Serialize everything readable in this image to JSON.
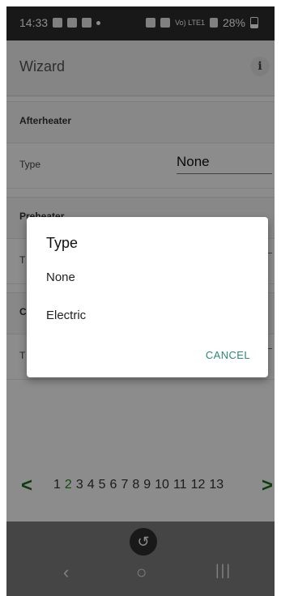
{
  "status_bar": {
    "time": "14:33",
    "battery": "28%",
    "net": "Vo) LTE1"
  },
  "app_bar": {
    "title": "Wizard",
    "info_icon": "i"
  },
  "sections": {
    "afterheater": {
      "title": "Afterheater",
      "type_label": "Type",
      "type_value": "None"
    },
    "preheater": {
      "title": "Preheater",
      "type_label": "T"
    },
    "third": {
      "title": "C",
      "type_label": "T"
    }
  },
  "pagination": {
    "prev": "<",
    "next": ">",
    "pages": [
      "1",
      "2",
      "3",
      "4",
      "5",
      "6",
      "7",
      "8",
      "9",
      "10",
      "11",
      "12",
      "13"
    ],
    "current": "2"
  },
  "dialog": {
    "title": "Type",
    "options": [
      "None",
      "Electric"
    ],
    "cancel_label": "CANCEL"
  },
  "colors": {
    "accent": "#1b8a1b",
    "dialog_action": "#2a8a72"
  }
}
